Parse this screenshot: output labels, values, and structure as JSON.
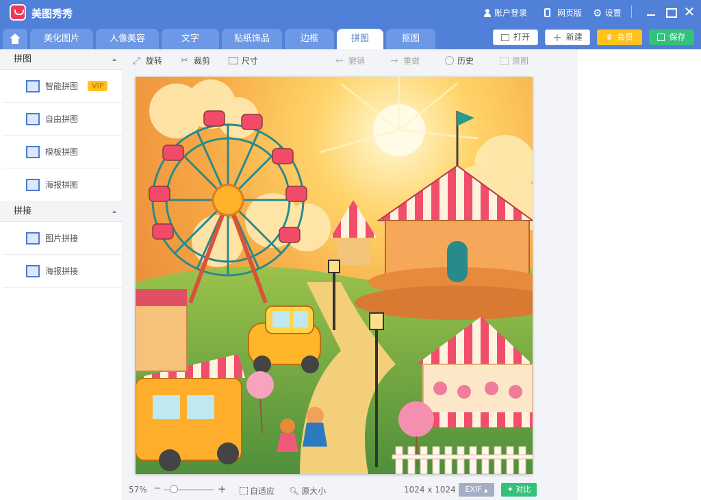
{
  "app": {
    "title": "美图秀秀"
  },
  "titlebar": {
    "account": "账户登录",
    "web_version": "网页版",
    "settings": "设置"
  },
  "tabs": [
    "美化图片",
    "人像美容",
    "文字",
    "贴纸饰品",
    "边框",
    "拼图",
    "抠图"
  ],
  "active_tab": "拼图",
  "actions": {
    "open": "打开",
    "new": "新建",
    "vip": "会员",
    "save": "保存"
  },
  "sidebar": {
    "sections": [
      {
        "title": "拼图",
        "items": [
          {
            "label": "智能拼图",
            "badge": "VIP"
          },
          {
            "label": "自由拼图"
          },
          {
            "label": "模板拼图"
          },
          {
            "label": "海报拼图"
          }
        ]
      },
      {
        "title": "拼接",
        "items": [
          {
            "label": "图片拼接"
          },
          {
            "label": "海报拼接"
          }
        ]
      }
    ]
  },
  "toolbar": {
    "rotate": "旋转",
    "crop": "裁剪",
    "size": "尺寸",
    "undo": "撤销",
    "redo": "重做",
    "history": "历史",
    "original": "原图"
  },
  "status": {
    "zoom": "57%",
    "zoom_fraction": 0.57,
    "fit": "自适应",
    "actual_size": "原大小",
    "dimensions": "1024 x 1024",
    "exif": "EXIF",
    "compare": "对比"
  },
  "colors": {
    "accent": "#5080d8",
    "tab_inactive": "#6d98e6",
    "vip": "#ffc21c",
    "save": "#33c27a"
  }
}
